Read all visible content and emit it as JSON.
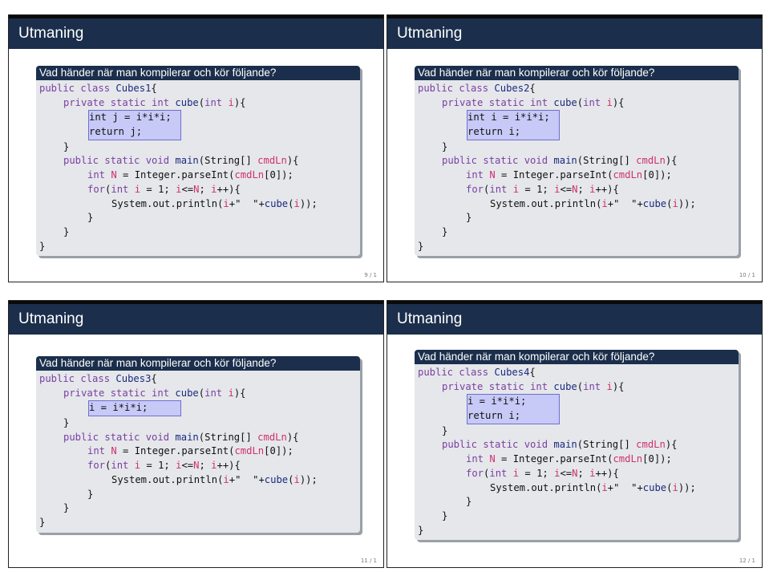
{
  "slides": [
    {
      "title": "Utmaning",
      "question": "Vad händer när man kompilerar och kör följande?",
      "class_name": "Cubes1",
      "body": [
        "int j = i*i*i;",
        "return j;"
      ],
      "page": "9 / 1"
    },
    {
      "title": "Utmaning",
      "question": "Vad händer när man kompilerar och kör följande?",
      "class_name": "Cubes2",
      "body": [
        "int i = i*i*i;",
        "return i;"
      ],
      "page": "10 / 1"
    },
    {
      "title": "Utmaning",
      "question": "Vad händer när man kompilerar och kör följande?",
      "class_name": "Cubes3",
      "body": [
        "i = i*i*i;"
      ],
      "page": "11 / 1"
    },
    {
      "title": "Utmaning",
      "question": "Vad händer när man kompilerar och kör följande?",
      "class_name": "Cubes4",
      "body": [
        "i = i*i*i;",
        "return i;"
      ],
      "page": "12 / 1"
    }
  ],
  "code": {
    "class_prefix": "public class ",
    "class_suffix": "{",
    "cube_sig": "private static int cube(int i){",
    "close": "}",
    "main_sig": "public static void main(String[] cmdLn){",
    "parse": "int N = Integer.parseInt(cmdLn[0]);",
    "for": "for(int i = 1; i<=N; i++){",
    "print": "System.out.println(i+\"  \"+cube(i));"
  },
  "colors": {
    "title_bar": "#1b2f4c",
    "block_bg": "#e5e7eb",
    "highlight": "#c7c9f6",
    "keyword": "#7a3fa0",
    "variable": "#d0306e"
  }
}
